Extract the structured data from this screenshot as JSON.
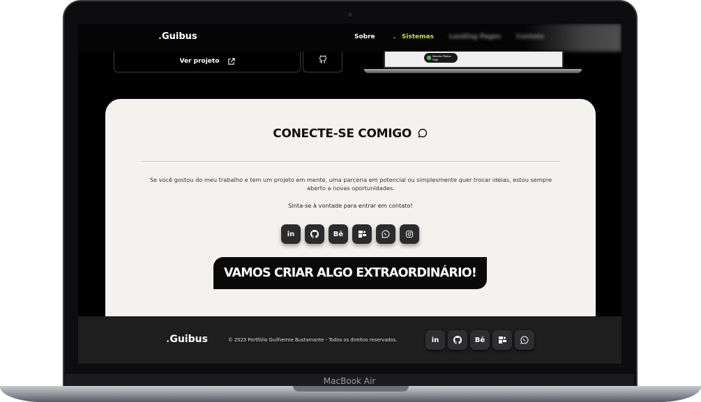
{
  "header": {
    "logo_dot": ".",
    "logo_text": "Guibus",
    "nav": [
      "Sobre",
      "Sistemas",
      "Landing Pages",
      "Contato"
    ]
  },
  "project": {
    "view_label": "Ver projeto",
    "toast_title": "Marcha Pilotos",
    "toast_sub": "Hoje"
  },
  "contact": {
    "title": "CONECTE-SE COMIGO",
    "paragraph": "Se você gostou do meu trabalho e tem um projeto em mente, uma parceria em potencial ou simplesmente quer trocar ideias, estou sempre aberto a novas oportunidades.",
    "invite": "Sinta-se à vontade para entrar em contato!",
    "socials": [
      "linkedin-icon",
      "github-icon",
      "behance-icon",
      "workana-icon",
      "whatsapp-icon",
      "instagram-icon"
    ],
    "behance_label": "Bē",
    "cta": "VAMOS CRIAR ALGO EXTRAORDINÁRIO!"
  },
  "footer": {
    "logo_dot": ".",
    "logo_text": "Guibus",
    "copyright": "© 2023 Portfólio Guilherme Bustamante - Todos os direitos reservados.",
    "behance_label": "Bē"
  },
  "device": {
    "label": "MacBook Air"
  },
  "colors": {
    "accent": "#c6e03a",
    "card_bg": "#f3f2ef",
    "dark": "#0a0a0a"
  }
}
